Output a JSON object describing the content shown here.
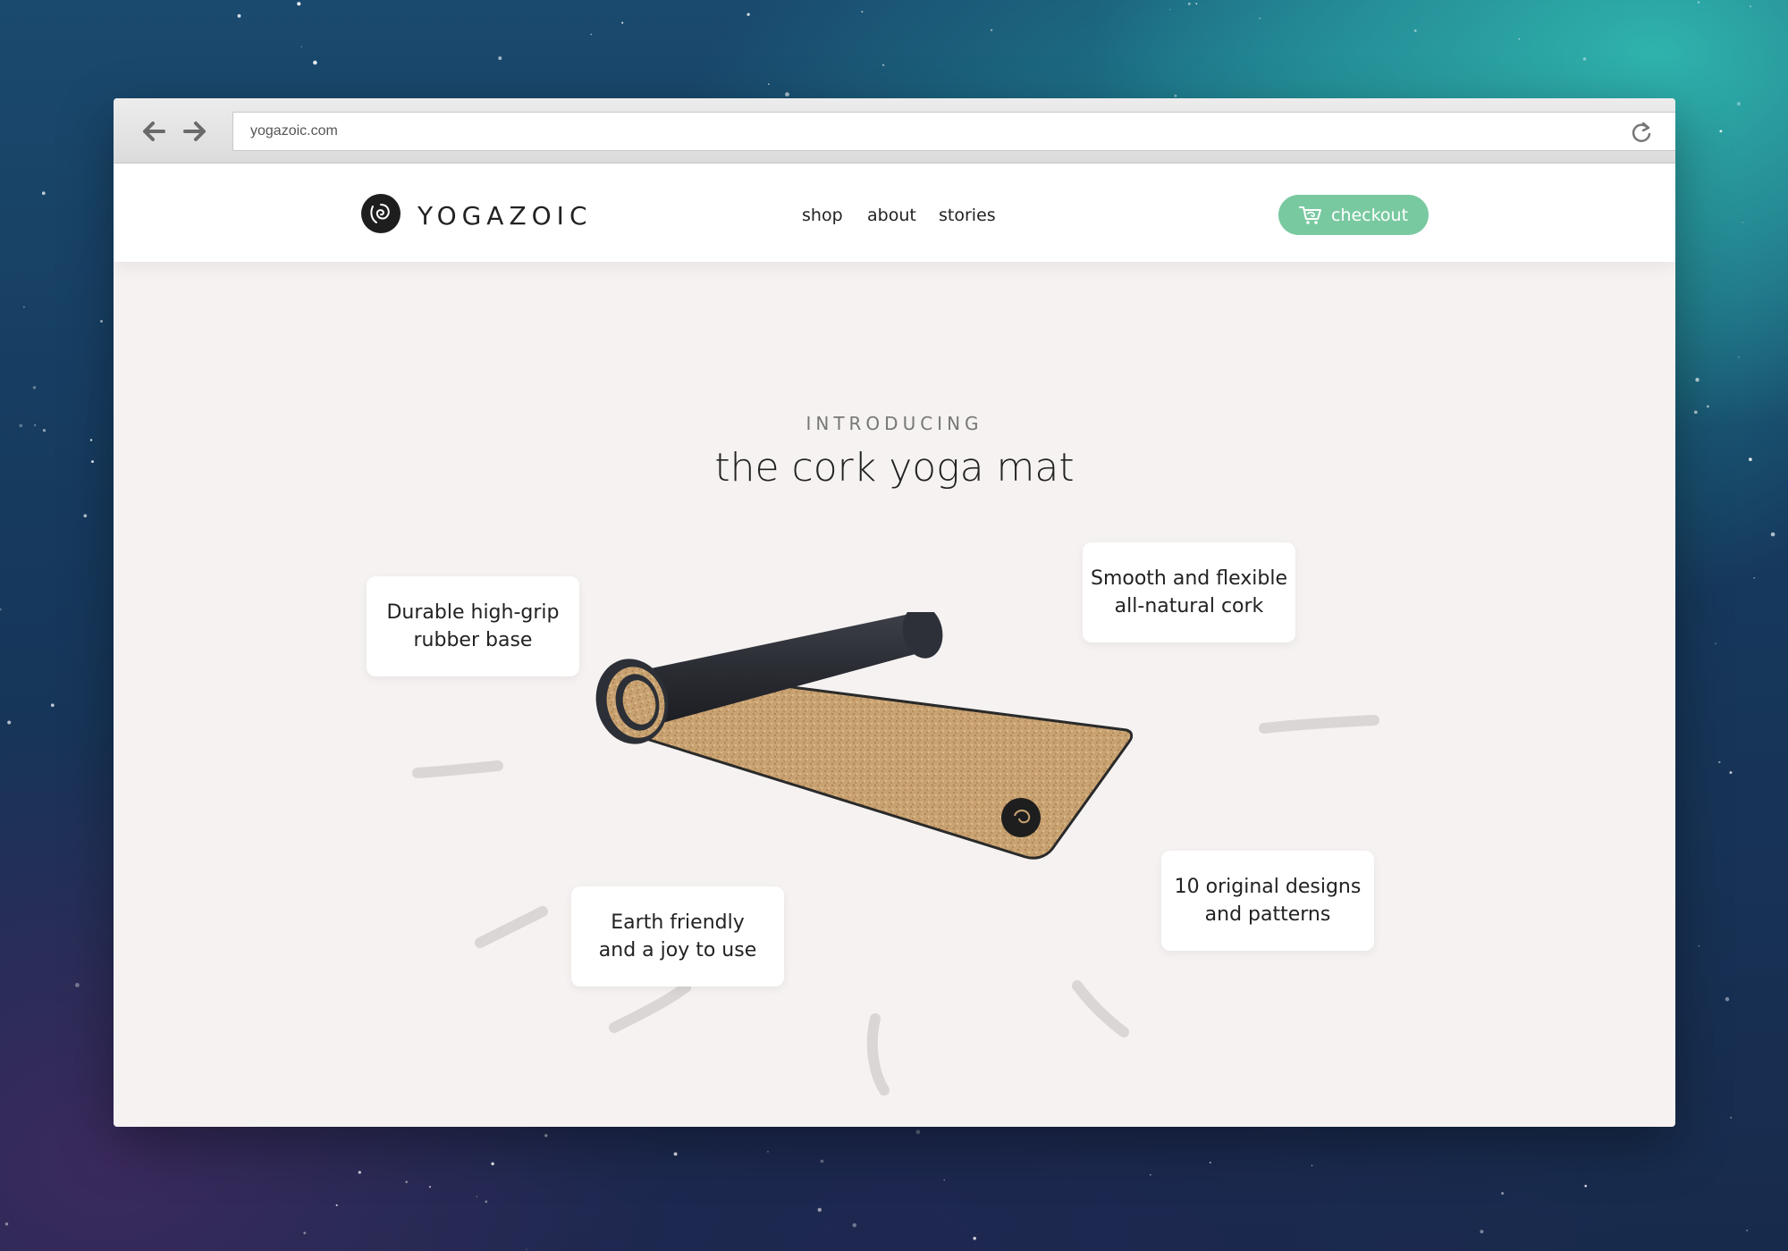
{
  "browser": {
    "url": "yogazoic.com"
  },
  "header": {
    "brand": "YOGAZOIC",
    "nav": {
      "shop": "shop",
      "about": "about",
      "stories": "stories"
    },
    "checkout": "checkout"
  },
  "hero": {
    "eyebrow": "INTRODUCING",
    "title": "the cork yoga mat"
  },
  "features": {
    "grip": [
      "Durable high-grip",
      "rubber base"
    ],
    "cork": [
      "Smooth and flexible",
      "all-natural cork"
    ],
    "earth": [
      "Earth friendly",
      "and a joy to use"
    ],
    "designs": [
      "10 original designs",
      "and patterns"
    ]
  },
  "colors": {
    "accent": "#79c9a0",
    "page_bg": "#f5f2f1",
    "text": "#222222"
  },
  "icons": [
    "back-arrow-icon",
    "forward-arrow-icon",
    "reload-icon",
    "logo-icon",
    "cart-icon"
  ]
}
